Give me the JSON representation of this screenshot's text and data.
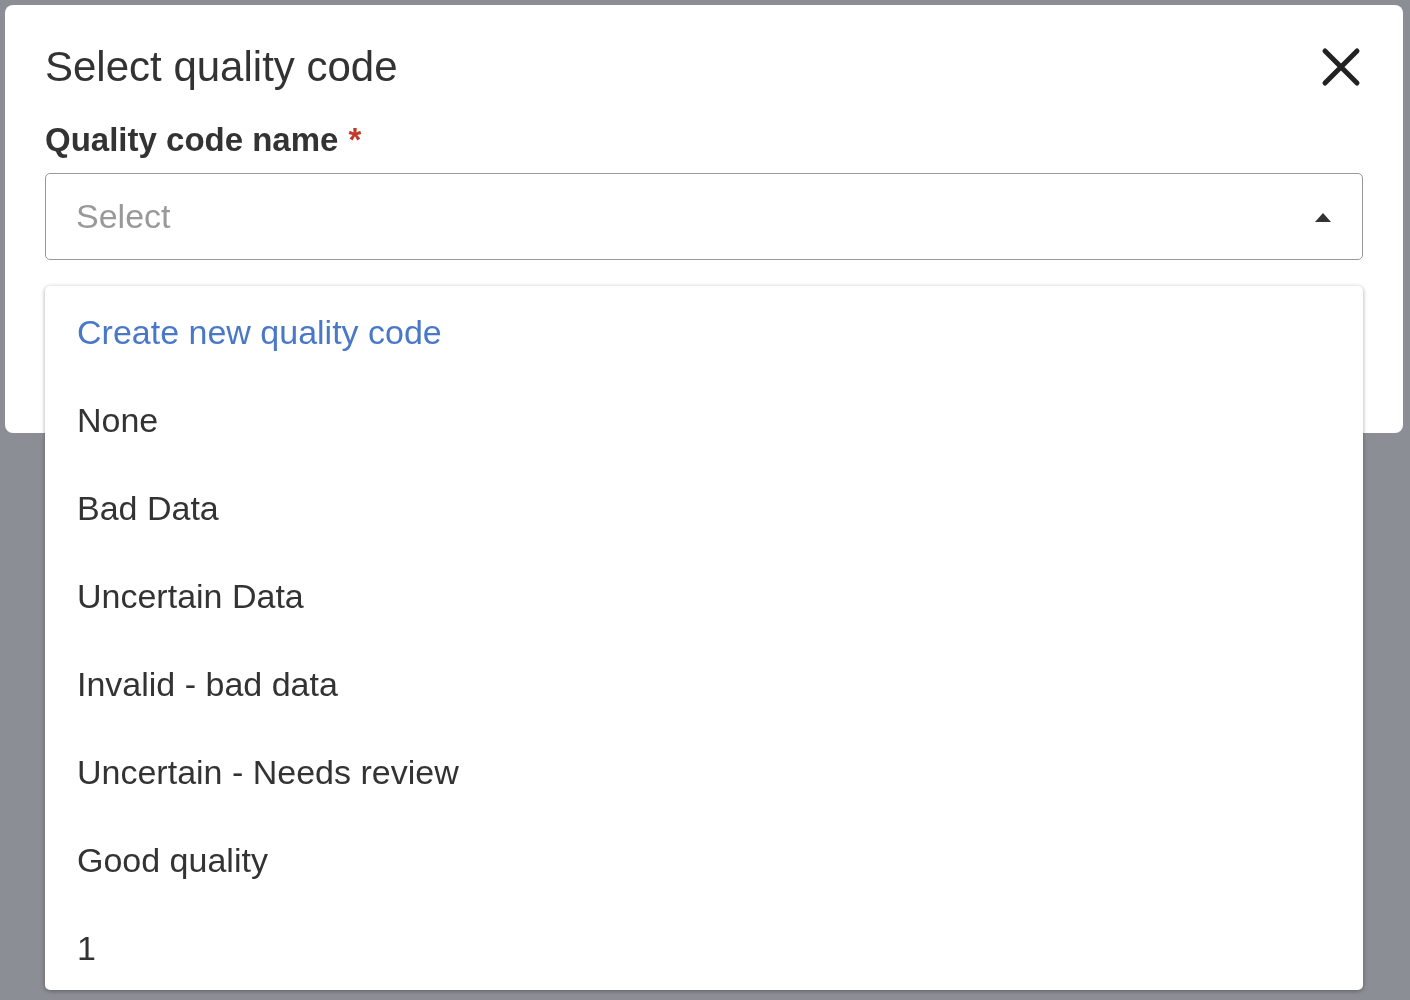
{
  "dialog": {
    "title": "Select quality code",
    "field": {
      "label": "Quality code name",
      "required_mark": "*",
      "placeholder": "Select",
      "expanded": true
    },
    "options": [
      {
        "label": "Create new quality code",
        "kind": "action"
      },
      {
        "label": "None",
        "kind": "option"
      },
      {
        "label": "Bad Data",
        "kind": "option"
      },
      {
        "label": "Uncertain Data",
        "kind": "option"
      },
      {
        "label": "Invalid - bad data",
        "kind": "option"
      },
      {
        "label": "Uncertain - Needs review",
        "kind": "option"
      },
      {
        "label": "Good quality",
        "kind": "option"
      },
      {
        "label": "1",
        "kind": "option"
      }
    ]
  }
}
